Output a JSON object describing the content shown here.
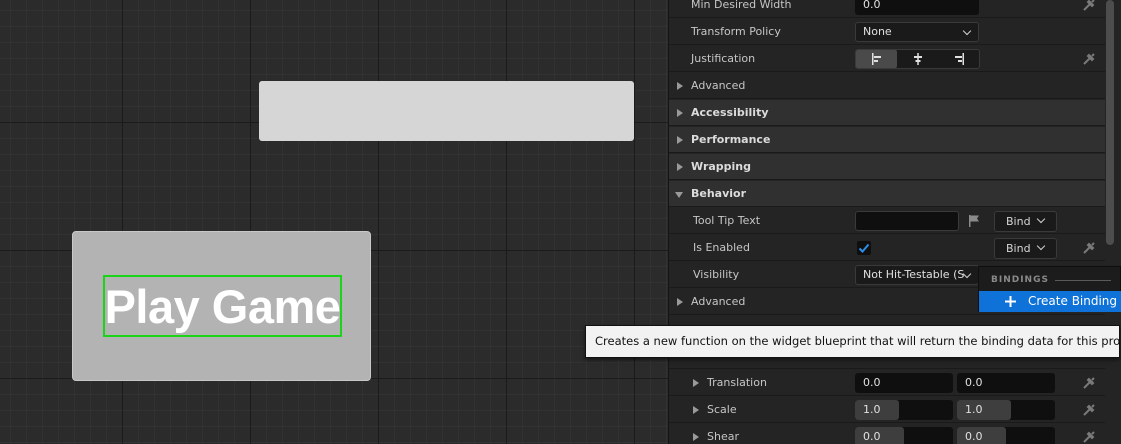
{
  "canvas": {
    "play_button_label": "Play Game"
  },
  "details": {
    "rows": {
      "min_desired_width": {
        "label": "Min Desired Width",
        "value": "0.0"
      },
      "transform_policy": {
        "label": "Transform Policy",
        "value": "None"
      },
      "justification": {
        "label": "Justification",
        "options": [
          "align-left-icon",
          "align-center-icon",
          "align-right-icon"
        ],
        "selected": "left"
      },
      "advanced_1": {
        "label": "Advanced"
      },
      "accessibility": {
        "label": "Accessibility"
      },
      "performance": {
        "label": "Performance"
      },
      "wrapping": {
        "label": "Wrapping"
      },
      "behavior": {
        "label": "Behavior"
      },
      "tool_tip_text": {
        "label": "Tool Tip Text",
        "value": "",
        "bind": "Bind"
      },
      "is_enabled": {
        "label": "Is Enabled",
        "checked": true,
        "bind": "Bind"
      },
      "visibility": {
        "label": "Visibility",
        "value": "Not Hit-Testable (S"
      },
      "advanced_2": {
        "label": "Advanced"
      },
      "translation": {
        "label": "Translation",
        "x": "0.0",
        "y": "0.0"
      },
      "scale": {
        "label": "Scale",
        "x": "1.0",
        "y": "1.0",
        "x_fill": 0.45,
        "y_fill": 0.55
      },
      "shear": {
        "label": "Shear",
        "x": "0.0",
        "y": "0.0",
        "x_fill": 0.5,
        "y_fill": 0.5
      }
    }
  },
  "bindings_menu": {
    "header": "BINDINGS",
    "create_binding": "Create Binding"
  },
  "tooltip": {
    "text": "Creates a new function on the widget blueprint that will return the binding data for this property."
  },
  "colors": {
    "accent": "#0e72d9",
    "selection_outline": "#19d419"
  }
}
